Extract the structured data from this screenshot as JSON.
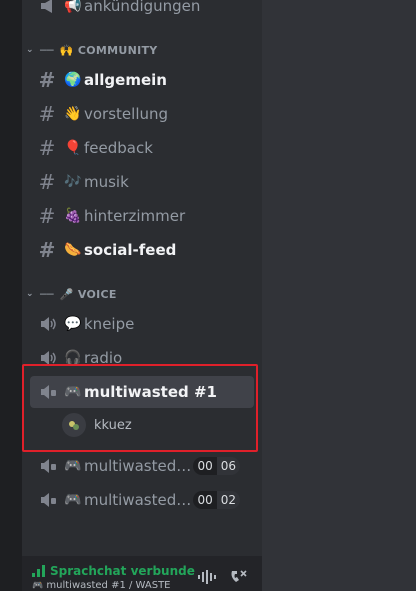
{
  "categories": {
    "community": "COMMUNITY",
    "voice": "VOICE"
  },
  "text_channels": [
    {
      "name": "ankündigungen",
      "icon": "megaphone-emoji"
    },
    {
      "name": "allgemein",
      "icon": "globe-emoji",
      "unread": true
    },
    {
      "name": "vorstellung",
      "icon": "waving-hand-emoji"
    },
    {
      "name": "feedback",
      "icon": "balloon-emoji"
    },
    {
      "name": "musik",
      "icon": "music-notes-emoji"
    },
    {
      "name": "hinterzimmer",
      "icon": "grapes-emoji"
    },
    {
      "name": "social-feed",
      "icon": "hotdog-emoji",
      "unread": true
    }
  ],
  "voice_channels": [
    {
      "name": "kneipe",
      "icon": "speech-bubble-emoji"
    },
    {
      "name": "radio",
      "icon": "headphones-emoji"
    },
    {
      "name": "multiwasted #1",
      "icon": "gamepad-emoji",
      "selected": true
    },
    {
      "name": "multiwasted…",
      "icon": "gamepad-emoji",
      "count": "00",
      "limit": "06"
    },
    {
      "name": "multiwasted…",
      "icon": "gamepad-emoji",
      "count": "00",
      "limit": "02"
    }
  ],
  "voice_users": [
    {
      "name": "kkuez"
    }
  ],
  "voice_connection": {
    "status": "Sprachchat verbunde",
    "subtitle": "multiwasted #1 / WASTE"
  },
  "colors": {
    "background": "#2b2d31",
    "selected": "#404249",
    "connected_green": "#23a55a",
    "highlight_red": "#e0202a"
  }
}
